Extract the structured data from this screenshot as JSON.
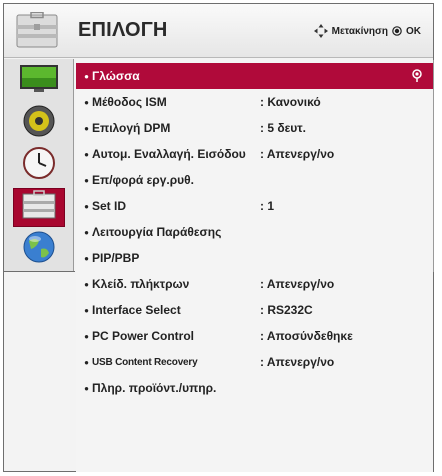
{
  "header": {
    "title": "ΕΠΙΛΟΓΗ",
    "nav_hint": "Μετακίνηση",
    "ok_label": "OK"
  },
  "sidebar": {
    "items": [
      {
        "name": "picture",
        "icon": "tv-picture-icon"
      },
      {
        "name": "audio",
        "icon": "speaker-icon"
      },
      {
        "name": "time",
        "icon": "clock-icon"
      },
      {
        "name": "option",
        "icon": "toolbox-icon",
        "active": true
      },
      {
        "name": "network",
        "icon": "globe-icon"
      }
    ]
  },
  "menu": {
    "items": [
      {
        "label": "Γλώσσα",
        "value": ""
      },
      {
        "label": "Μέθοδος ISM",
        "value": ": Κανονικό"
      },
      {
        "label": "Επιλογή DPM",
        "value": ": 5 δευτ."
      },
      {
        "label": "Αυτομ. Εναλλαγή. Εισόδου",
        "value": ": Απενεργ/νο"
      },
      {
        "label": "Επ/φορά εργ.ρυθ.",
        "value": ""
      },
      {
        "label": "Set ID",
        "value": ": 1"
      },
      {
        "label": "Λειτουργία Παράθεσης",
        "value": ""
      },
      {
        "label": "PIP/PBP",
        "value": ""
      },
      {
        "label": "Κλείδ. πλήκτρων",
        "value": ": Απενεργ/νο"
      },
      {
        "label": "Interface Select",
        "value": ": RS232C"
      },
      {
        "label": "PC Power Control",
        "value": ": Αποσύνδεθηκε"
      },
      {
        "label": "USB Content Recovery",
        "value": ": Απενεργ/νο"
      },
      {
        "label": "Πληρ. προϊόντ./υπηρ.",
        "value": ""
      }
    ]
  },
  "colors": {
    "selected_row": "#b00a3a",
    "active_sidebar": "#a8062f"
  }
}
